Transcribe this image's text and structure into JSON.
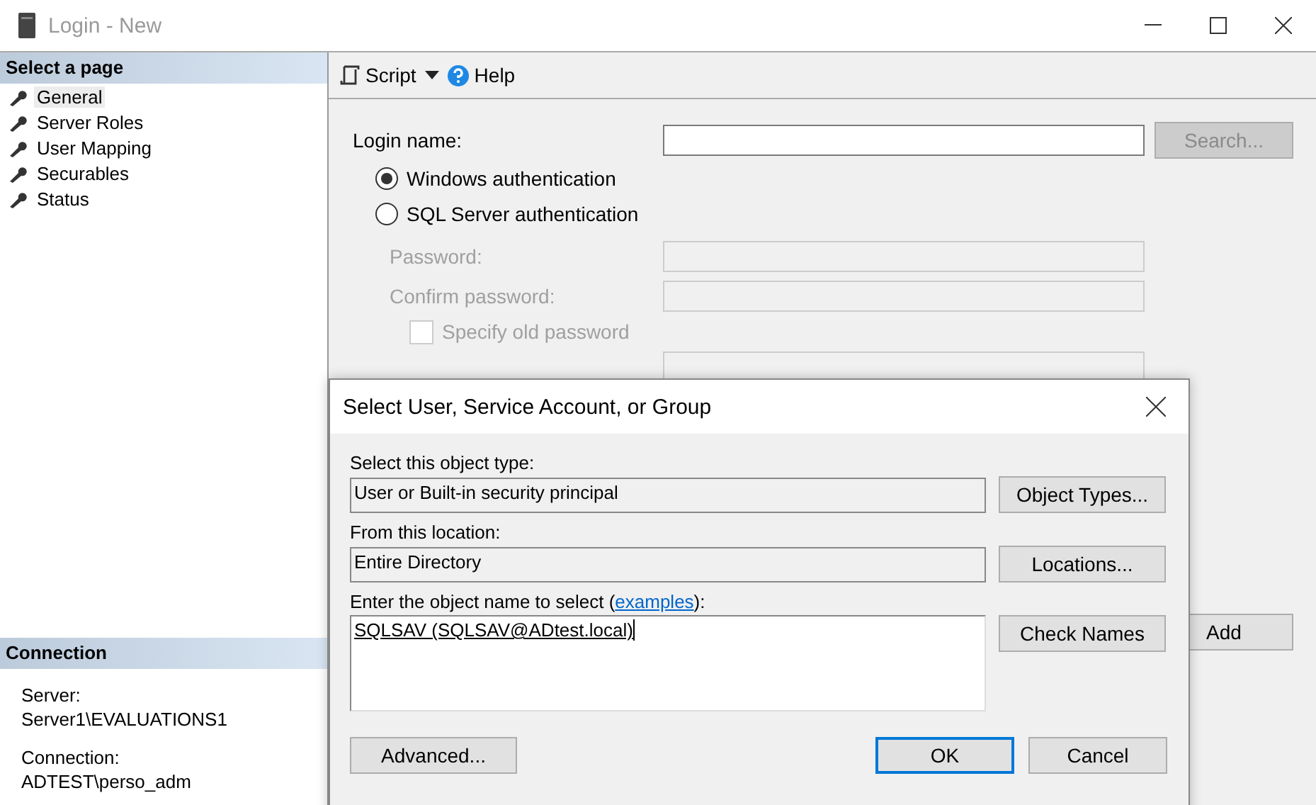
{
  "window": {
    "title": "Login - New"
  },
  "sidebar": {
    "header": "Select a page",
    "items": [
      {
        "label": "General",
        "selected": true
      },
      {
        "label": "Server Roles",
        "selected": false
      },
      {
        "label": "User Mapping",
        "selected": false
      },
      {
        "label": "Securables",
        "selected": false
      },
      {
        "label": "Status",
        "selected": false
      }
    ]
  },
  "connection": {
    "header": "Connection",
    "entries": [
      {
        "label": "Server:",
        "value": "Server1\\EVALUATIONS1"
      },
      {
        "label": "Connection:",
        "value": "ADTEST\\perso_adm"
      }
    ]
  },
  "toolbar": {
    "script": "Script",
    "help": "Help"
  },
  "form": {
    "login_name_label": "Login name:",
    "search_button": "Search...",
    "auth_options": [
      {
        "label": "Windows authentication",
        "selected": true
      },
      {
        "label": "SQL Server authentication",
        "selected": false
      }
    ],
    "password_label": "Password:",
    "confirm_label": "Confirm password:",
    "old_password": {
      "label": "Specify old password",
      "checked": false,
      "disabled": true
    },
    "add_button": "Add"
  },
  "dialog": {
    "title": "Select User, Service Account, or Group",
    "object_type_label": "Select this object type:",
    "object_type": "User or Built-in security principal",
    "object_types_button": "Object Types...",
    "location_label": "From this location:",
    "location": "Entire Directory",
    "locations_button": "Locations...",
    "name_label": "Enter the object name to select (",
    "name_link": "examples",
    "name_label_end": "):",
    "name_value": "SQLSAV (SQLSAV@ADtest.local)",
    "check_names_button": "Check Names",
    "advanced_button": "Advanced...",
    "ok_button": "OK",
    "cancel_button": "Cancel"
  }
}
